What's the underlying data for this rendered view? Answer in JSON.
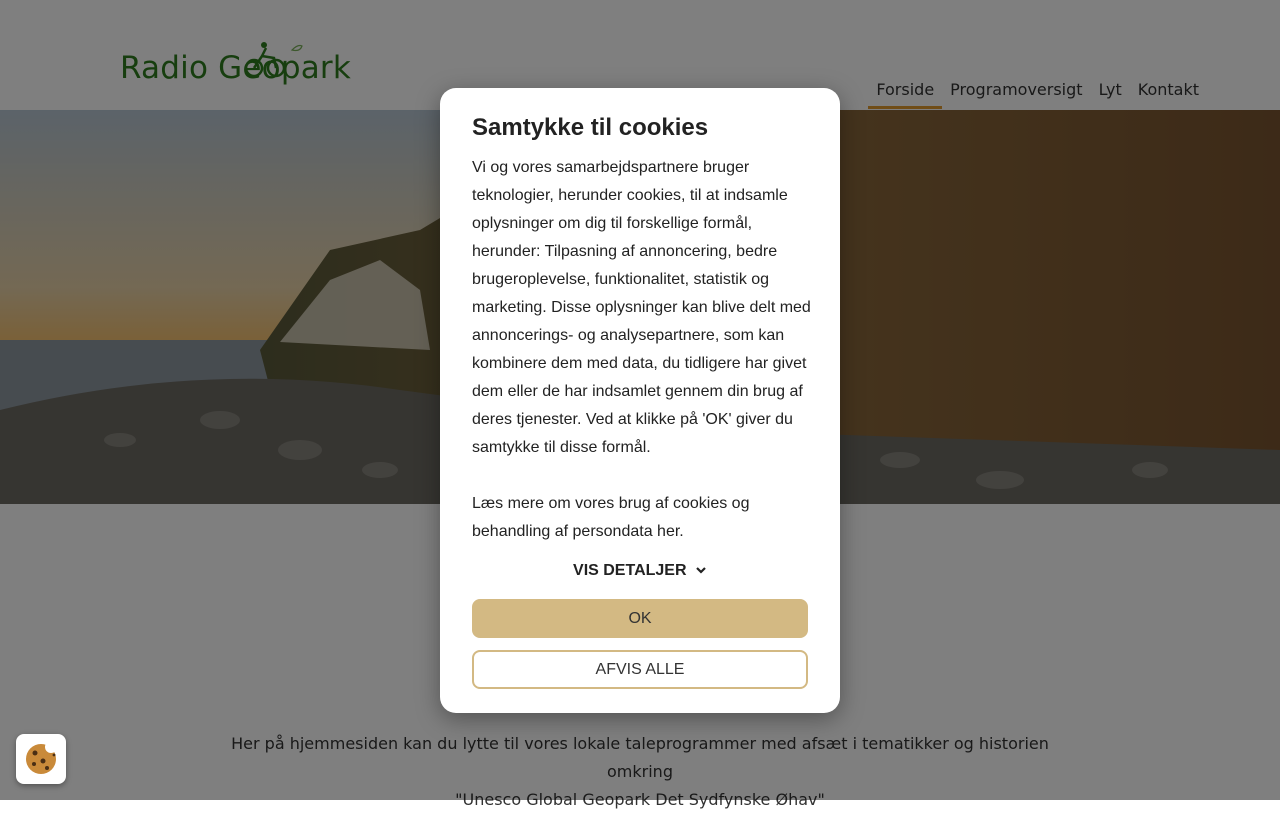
{
  "header": {
    "logo_text": "Radio Geopark",
    "nav": [
      {
        "label": "Forside",
        "active": true
      },
      {
        "label": "Programoversigt",
        "active": false
      },
      {
        "label": "Lyt",
        "active": false
      },
      {
        "label": "Kontakt",
        "active": false
      }
    ]
  },
  "main": {
    "intro_line1": "Her på hjemmesiden kan du lytte til vores lokale taleprogrammer med afsæt i tematikker og historien omkring",
    "intro_line2": "\"Unesco Global Geopark Det Sydfynske Øhav\""
  },
  "cookie_dialog": {
    "title": "Samtykke til cookies",
    "paragraph1": "Vi og vores samarbejdspartnere bruger teknologier, herunder cookies, til at indsamle oplysninger om dig til forskellige formål, herunder: Tilpasning af annoncering, bedre brugeroplevelse, funktionalitet, statistik og marketing. Disse oplysninger kan blive delt med annoncerings- og analysepartnere, som kan kombinere dem med data, du tidligere har givet dem eller de har indsamlet gennem din brug af deres tjenester. Ved at klikke på 'OK' giver du samtykke til disse formål.",
    "paragraph2": "Læs mere om vores brug af cookies og behandling af persondata her.",
    "details_label": "VIS DETALJER",
    "ok_label": "OK",
    "reject_label": "AFVIS ALLE"
  },
  "colors": {
    "brand_green": "#2e7d1f",
    "accent_gold": "#d3b983",
    "nav_underline": "#e09a2e"
  },
  "icons": {
    "cookie_fab": "cookie-icon",
    "details": "chevron-down-icon"
  }
}
